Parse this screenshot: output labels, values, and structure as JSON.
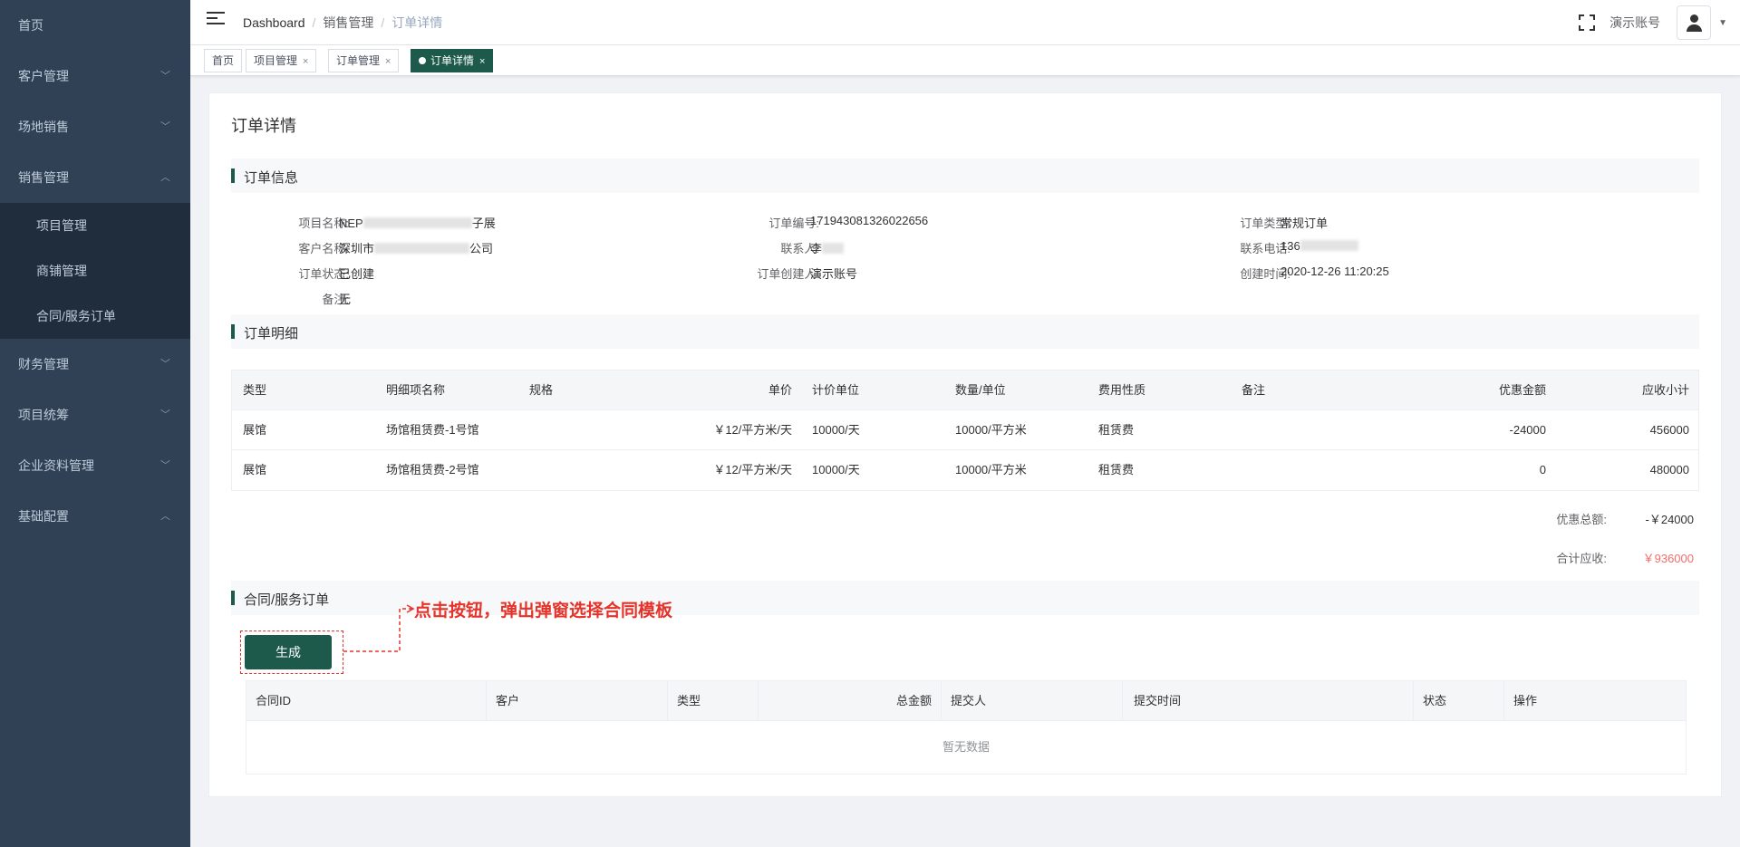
{
  "sidebar": {
    "items": [
      {
        "label": "首页"
      },
      {
        "label": "客户管理",
        "chevron": "chevron-down-icon"
      },
      {
        "label": "场地销售",
        "chevron": "chevron-down-icon"
      },
      {
        "label": "销售管理",
        "chevron": "chevron-up-icon",
        "expanded": true
      },
      {
        "label": "财务管理",
        "chevron": "chevron-down-icon"
      },
      {
        "label": "项目统筹",
        "chevron": "chevron-down-icon"
      },
      {
        "label": "企业资料管理",
        "chevron": "chevron-down-icon"
      },
      {
        "label": "基础配置",
        "chevron": "chevron-up-icon"
      }
    ],
    "submenu": [
      {
        "label": "项目管理"
      },
      {
        "label": "商铺管理"
      },
      {
        "label": "合同/服务订单"
      }
    ]
  },
  "header": {
    "breadcrumb": [
      "Dashboard",
      "销售管理",
      "订单详情"
    ],
    "username": "演示账号"
  },
  "tags": [
    {
      "label": "首页"
    },
    {
      "label": "项目管理"
    },
    {
      "label": "订单管理"
    },
    {
      "label": "订单详情",
      "active": true
    }
  ],
  "page": {
    "title": "订单详情"
  },
  "order_info": {
    "section_title": "订单信息",
    "project_name_label": "项目名称:",
    "project_name_prefix": "NEP",
    "project_name_suffix": "子展",
    "order_no_label": "订单编号:",
    "order_no": "171943081326022656",
    "order_type_label": "订单类型:",
    "order_type": "常规订单",
    "customer_label": "客户名称:",
    "customer_prefix": "深圳市",
    "customer_suffix": "公司",
    "contact_label": "联系人:",
    "contact_prefix": "李",
    "phone_label": "联系电话:",
    "phone_prefix": "136",
    "status_label": "订单状态:",
    "status": "已创建",
    "creator_label": "订单创建人:",
    "creator": "演示账号",
    "created_label": "创建时间:",
    "created": "2020-12-26 11:20:25",
    "remark_label": "备注:",
    "remark": "无"
  },
  "detail": {
    "section_title": "订单明细",
    "columns": [
      "类型",
      "明细项名称",
      "规格",
      "单价",
      "计价单位",
      "数量/单位",
      "费用性质",
      "备注",
      "优惠金额",
      "应收小计"
    ],
    "rows": [
      [
        "展馆",
        "场馆租赁费-1号馆",
        "",
        "￥12/平方米/天",
        "10000/天",
        "10000/平方米",
        "租赁费",
        "",
        "-24000",
        "456000"
      ],
      [
        "展馆",
        "场馆租赁费-2号馆",
        "",
        "￥12/平方米/天",
        "10000/天",
        "10000/平方米",
        "租赁费",
        "",
        "0",
        "480000"
      ]
    ],
    "discount_total_label": "优惠总额:",
    "discount_total": "-￥24000",
    "total_label": "合计应收:",
    "total": "￥936000"
  },
  "contract": {
    "section_title": "合同/服务订单",
    "generate_label": "生成",
    "annotation": "点击按钮，弹出弹窗选择合同模板",
    "columns": [
      "合同ID",
      "客户",
      "类型",
      "总金额",
      "提交人",
      "提交时间",
      "状态",
      "操作"
    ],
    "empty_text": "暂无数据"
  },
  "colors": {
    "sidebar_bg": "#304156",
    "submenu_bg": "#1f2d3d",
    "accent": "#1e5a4c",
    "total_red": "#f56c6c",
    "annotation_red": "#e6332a"
  }
}
